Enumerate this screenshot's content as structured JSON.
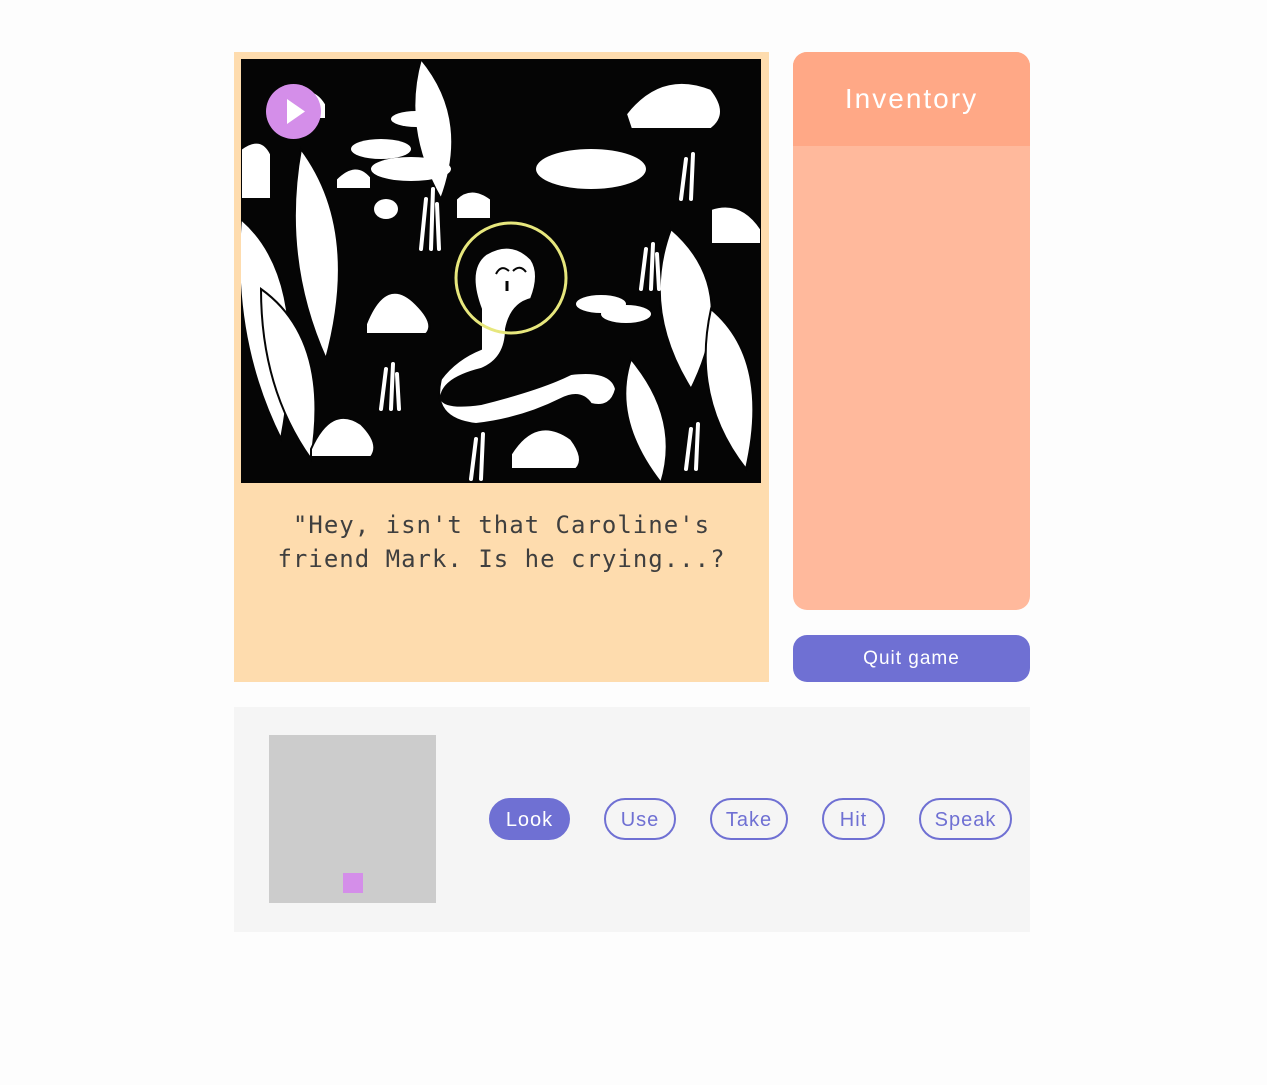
{
  "scene": {
    "dialogue": "\"Hey, isn't that Caroline's friend Mark. Is he crying...?",
    "play_icon": "play-icon"
  },
  "inventory": {
    "title": "Inventory",
    "items": []
  },
  "quit_label": "Quit game",
  "verbs": [
    {
      "label": "Look",
      "active": true
    },
    {
      "label": "Use",
      "active": false
    },
    {
      "label": "Take",
      "active": false
    },
    {
      "label": "Hit",
      "active": false
    },
    {
      "label": "Speak",
      "active": false
    }
  ],
  "colors": {
    "accent": "#6f70d3",
    "player": "#d48ee9",
    "scene_panel": "#fedcae",
    "inventory_header": "#ffa886",
    "inventory_body": "#ffb99c",
    "hotspot_ring": "#e7e77d"
  }
}
